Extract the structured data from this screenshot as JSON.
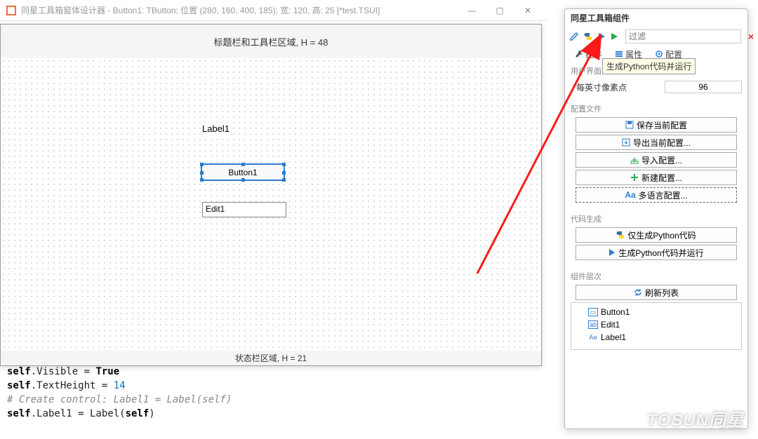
{
  "designer": {
    "title": "同星工具箱窗体设计器 - Button1: TButton; 位置 (280, 160, 400, 185); 宽: 120, 高: 25 [*test.TSUI]",
    "title_bar_zone": "标题栏和工具栏区域, H = 48",
    "status_zone": "状态栏区域, H = 21",
    "label1": "Label1",
    "button1": "Button1",
    "edit1": "Edit1"
  },
  "right": {
    "title": "同星工具箱组件",
    "filter_placeholder": "过滤",
    "tabs": {
      "controls": "控件",
      "properties": "属性",
      "layout": "配置"
    },
    "tooltip": "生成Python代码并运行",
    "ui_section": {
      "title": "用户界面",
      "dpi_label": "每英寸像素点",
      "dpi_value": "96"
    },
    "config_section": {
      "title": "配置文件",
      "save": "保存当前配置",
      "export": "导出当前配置...",
      "import": "导入配置...",
      "new": "新建配置...",
      "lang": "多语言配置..."
    },
    "codegen_section": {
      "title": "代码生成",
      "gen_only": "仅生成Python代码",
      "gen_run": "生成Python代码并运行"
    },
    "tree_section": {
      "title": "组件层次",
      "refresh": "刷新列表",
      "items": [
        "Button1",
        "Edit1",
        "Label1"
      ]
    }
  },
  "code": {
    "l1a": "self",
    "l1b": ".Visible = ",
    "l1c": "True",
    "l2a": "self",
    "l2b": ".TextHeight = ",
    "l2c": "14",
    "l3": "# Create control: Label1 = Label(self)",
    "l4a": "self",
    "l4b": ".Label1 = Label(",
    "l4c": "self",
    "l4d": ")"
  },
  "watermark": "TOSUN同星"
}
